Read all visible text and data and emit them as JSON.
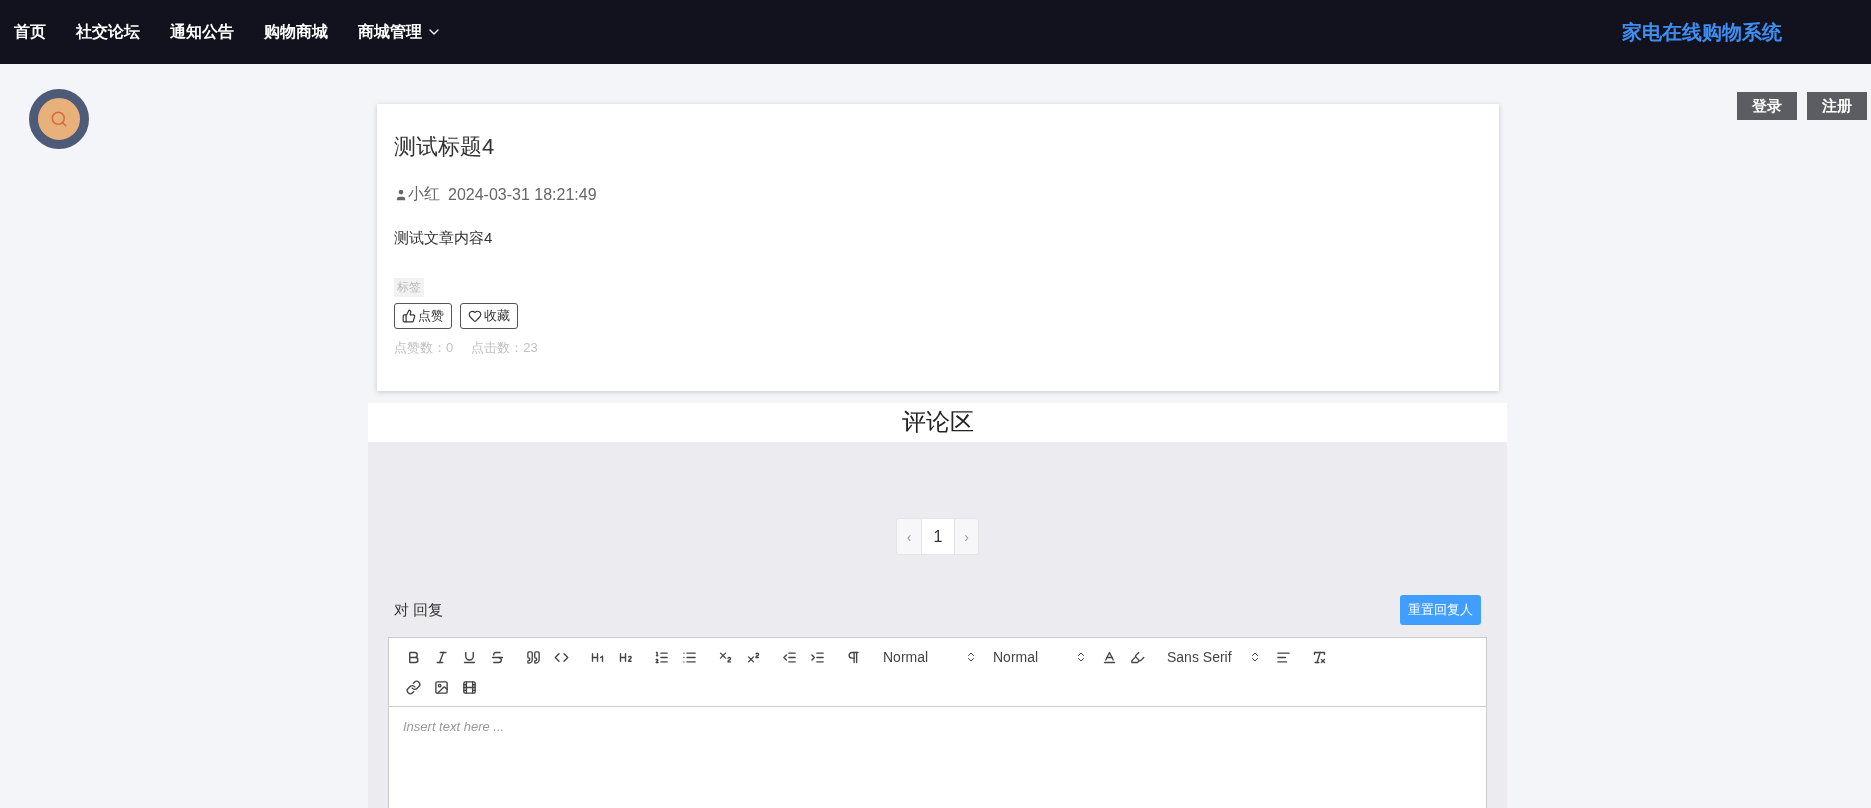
{
  "nav": {
    "items": [
      {
        "label": "首页",
        "dropdown": false
      },
      {
        "label": "社交论坛",
        "dropdown": false
      },
      {
        "label": "通知公告",
        "dropdown": false
      },
      {
        "label": "购物商城",
        "dropdown": false
      },
      {
        "label": "商城管理",
        "dropdown": true
      }
    ],
    "brand": "家电在线购物系统"
  },
  "auth": {
    "buttons": [
      {
        "label": "登录"
      },
      {
        "label": "注册"
      }
    ]
  },
  "article": {
    "title": "测试标题4",
    "author": "小红",
    "date": "2024-03-31 18:21:49",
    "content": "测试文章内容4",
    "tag": "标签",
    "actions": [
      {
        "kind": "like",
        "label": "点赞"
      },
      {
        "kind": "favorite",
        "label": "收藏"
      }
    ],
    "stats": [
      "点赞数：0",
      "点击数：23"
    ]
  },
  "comments": {
    "heading": "评论区",
    "pagination": {
      "prev": "‹",
      "pages": [
        {
          "label": "1",
          "selected": true
        }
      ],
      "next": "›"
    },
    "reply_label": "对 回复",
    "reset_button": "重置回复人"
  },
  "editor": {
    "toolbar": [
      {
        "kind": "button"
      },
      {
        "kind": "button"
      },
      {
        "kind": "button"
      },
      {
        "kind": "button"
      },
      {
        "kind": "gap"
      },
      {
        "kind": "button"
      },
      {
        "kind": "button"
      },
      {
        "kind": "gap"
      },
      {
        "kind": "button"
      },
      {
        "kind": "button"
      },
      {
        "kind": "gap"
      },
      {
        "kind": "button"
      },
      {
        "kind": "button"
      },
      {
        "kind": "gap"
      },
      {
        "kind": "button"
      },
      {
        "kind": "button"
      },
      {
        "kind": "gap"
      },
      {
        "kind": "button"
      },
      {
        "kind": "button"
      },
      {
        "kind": "gap"
      },
      {
        "kind": "button"
      },
      {
        "kind": "gap"
      },
      {
        "kind": "picker",
        "value": "Normal"
      },
      {
        "kind": "picker",
        "value": "Normal"
      },
      {
        "kind": "button"
      },
      {
        "kind": "button"
      },
      {
        "kind": "gap"
      },
      {
        "kind": "picker",
        "value": "Sans Serif"
      },
      {
        "kind": "button"
      },
      {
        "kind": "gap"
      },
      {
        "kind": "button"
      },
      {
        "kind": "break"
      },
      {
        "kind": "button"
      },
      {
        "kind": "button"
      },
      {
        "kind": "button"
      }
    ],
    "placeholder": "Insert text here ..."
  }
}
